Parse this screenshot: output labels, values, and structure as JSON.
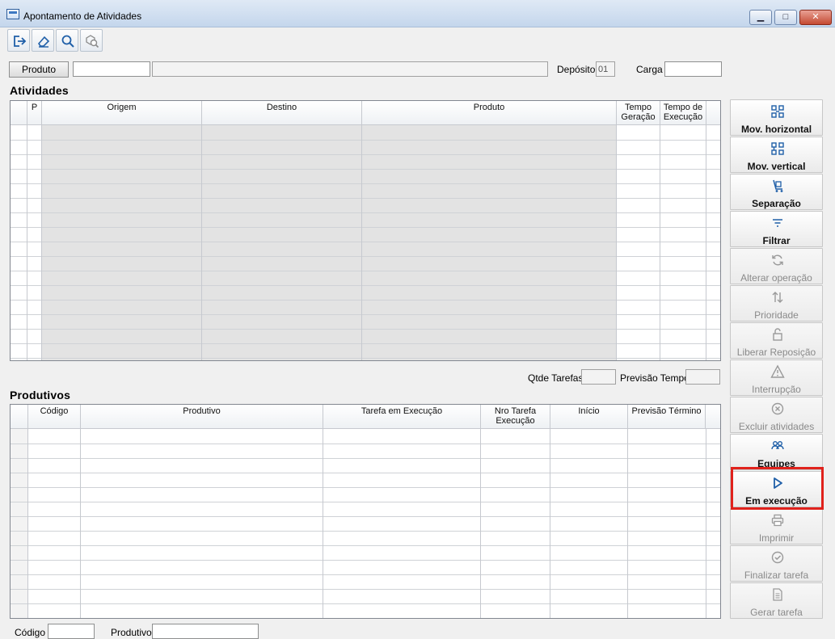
{
  "window": {
    "title": "Apontamento de Atividades",
    "controls": {
      "minimize_icon": "minimize-icon",
      "maximize_icon": "maximize-icon",
      "close_icon": "close-icon"
    }
  },
  "toolbar": {
    "buttons": [
      {
        "name": "exit",
        "icon": "exit-icon"
      },
      {
        "name": "clear",
        "icon": "eraser-icon"
      },
      {
        "name": "search",
        "icon": "search-icon"
      },
      {
        "name": "advanced-search",
        "icon": "advanced-search-icon"
      }
    ]
  },
  "filter": {
    "produto_button": "Produto",
    "produto_code_value": "",
    "produto_desc_value": "",
    "deposito_label": "Depósito",
    "deposito_value": "01",
    "carga_label": "Carga",
    "carga_value": ""
  },
  "atividades": {
    "title": "Atividades",
    "columns": [
      "",
      "P",
      "Origem",
      "Destino",
      "Produto",
      "Tempo Geração",
      "Tempo de Execução"
    ],
    "rows": []
  },
  "summary": {
    "qtde_tarefas_label": "Qtde Tarefas",
    "qtde_tarefas_value": "",
    "previsao_tempo_label": "Previsão Tempo",
    "previsao_tempo_value": ""
  },
  "produtivos": {
    "title": "Produtivos",
    "columns": [
      "",
      "Código",
      "Produtivo",
      "Tarefa em Execução",
      "Nro Tarefa Execução",
      "Início",
      "Previsão Término"
    ],
    "rows": []
  },
  "footer": {
    "codigo_label": "Código",
    "codigo_value": "",
    "produtivo_label": "Produtivo",
    "produtivo_value": ""
  },
  "side_buttons": [
    {
      "label": "Mov. horizontal",
      "icon": "horizontal-move-icon",
      "enabled": true
    },
    {
      "label": "Mov. vertical",
      "icon": "vertical-move-icon",
      "enabled": true
    },
    {
      "label": "Separação",
      "icon": "separation-cart-icon",
      "enabled": true
    },
    {
      "label": "Filtrar",
      "icon": "filter-icon",
      "enabled": true
    },
    {
      "label": "Alterar operação",
      "icon": "refresh-icon",
      "enabled": false
    },
    {
      "label": "Prioridade",
      "icon": "priority-arrows-icon",
      "enabled": false
    },
    {
      "label": "Liberar Reposição",
      "icon": "unlock-icon",
      "enabled": false
    },
    {
      "label": "Interrupção",
      "icon": "warning-icon",
      "enabled": false
    },
    {
      "label": "Excluir atividades",
      "icon": "delete-circle-icon",
      "enabled": false
    },
    {
      "label": "Equipes",
      "icon": "team-icon",
      "enabled": true
    },
    {
      "label": "Em execução",
      "icon": "play-icon",
      "enabled": true
    },
    {
      "label": "Imprimir",
      "icon": "print-icon",
      "enabled": false
    },
    {
      "label": "Finalizar tarefa",
      "icon": "check-circle-icon",
      "enabled": false
    },
    {
      "label": "Gerar tarefa",
      "icon": "document-icon",
      "enabled": false
    }
  ],
  "colors": {
    "accent": "#1f5fa8",
    "highlight": "#e0221c",
    "disabled": "#8a8a8a"
  }
}
